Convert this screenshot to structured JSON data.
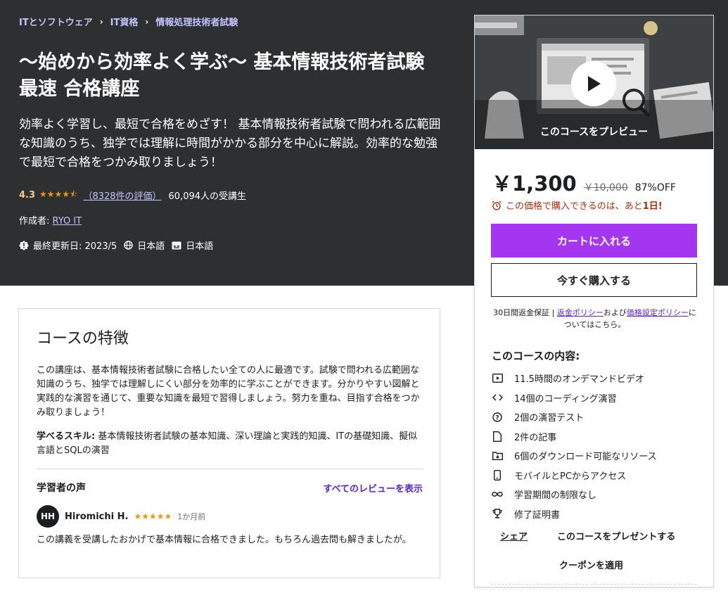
{
  "breadcrumb": [
    "ITとソフトウェア",
    "IT資格",
    "情報処理技術者試験"
  ],
  "course": {
    "title": "〜始めから効率よく学ぶ〜 基本情報技術者試験 最速 合格講座",
    "description": "効率よく学習し、最短で合格をめざす！ 基本情報技術者試験で問われる広範囲な知識のうち、独学では理解に時間がかかる部分を中心に解説。効率的な勉強で最短で合格をつかみ取りましょう！",
    "rating": "4.3",
    "rating_count": "（8328件の評価）",
    "students": "60,094人の受講生",
    "author_label": "作成者:",
    "author_name": "RYO IT",
    "last_updated": "最終更新日: 2023/5",
    "language": "日本語",
    "captions": "日本語"
  },
  "features": {
    "title": "コースの特徴",
    "body": "この講座は、基本情報技術者試験に合格したい全ての人に最適です。試験で問われる広範囲な知識のうち、独学では理解しにくい部分を効率的に学ぶことができます。分かりやすい図解と実践的な演習を通じて、重要な知識を最短で習得しましょう。努力を重ね、目指す合格をつかみ取りましょう！",
    "skills_label": "学べるスキル:",
    "skills": " 基本情報技術者試験の基本知識、深い理論と実践的知識、ITの基礎知識、擬似言語とSQLの演習",
    "voice_title": "学習者の声",
    "voice_link": "すべてのレビューを表示",
    "review": {
      "initials": "HH",
      "name": "Hiromichi H.",
      "stars": "★★★★★",
      "time": "1か月前",
      "text": "この講義を受講したおかげで基本情報に合格できました。もちろん過去問も解きましたが。"
    }
  },
  "sidebar": {
    "preview_caption": "このコースをプレビュー",
    "price": "￥1,300",
    "original_price": "￥10,000",
    "discount": "87%OFF",
    "urgency_prefix": "この価格で購入できるのは、あと",
    "urgency_days": "1日!",
    "cart_button": "カートに入れる",
    "buy_button": "今すぐ購入する",
    "refund_text": "30日間返金保証 | ",
    "refund_link": "返金ポリシー",
    "refund_and": "および",
    "pricing_link": "価格設定ポリシー",
    "refund_tail": "についてはこちら。",
    "includes_title": "このコースの内容:",
    "includes": [
      {
        "icon": "video-icon",
        "label": "11.5時間のオンデマンドビデオ"
      },
      {
        "icon": "code-icon",
        "label": "14個のコーディング演習"
      },
      {
        "icon": "question-icon",
        "label": "2個の演習テスト"
      },
      {
        "icon": "file-icon",
        "label": "2件の記事"
      },
      {
        "icon": "download-icon",
        "label": "6個のダウンロード可能なリソース"
      },
      {
        "icon": "mobile-icon",
        "label": "モバイルとPCからアクセス"
      },
      {
        "icon": "infinity-icon",
        "label": "学習期間の制限なし"
      },
      {
        "icon": "trophy-icon",
        "label": "修了証明書"
      }
    ],
    "share": "シェア",
    "gift": "このコースをプレゼントする",
    "coupon": "クーポンを適用"
  },
  "colors": {
    "hero_bg": "#2d2f31",
    "accent_purple": "#a435f0",
    "link_purple": "#5624d0",
    "star": "#e59819",
    "urgency_red": "#b32d0f"
  }
}
